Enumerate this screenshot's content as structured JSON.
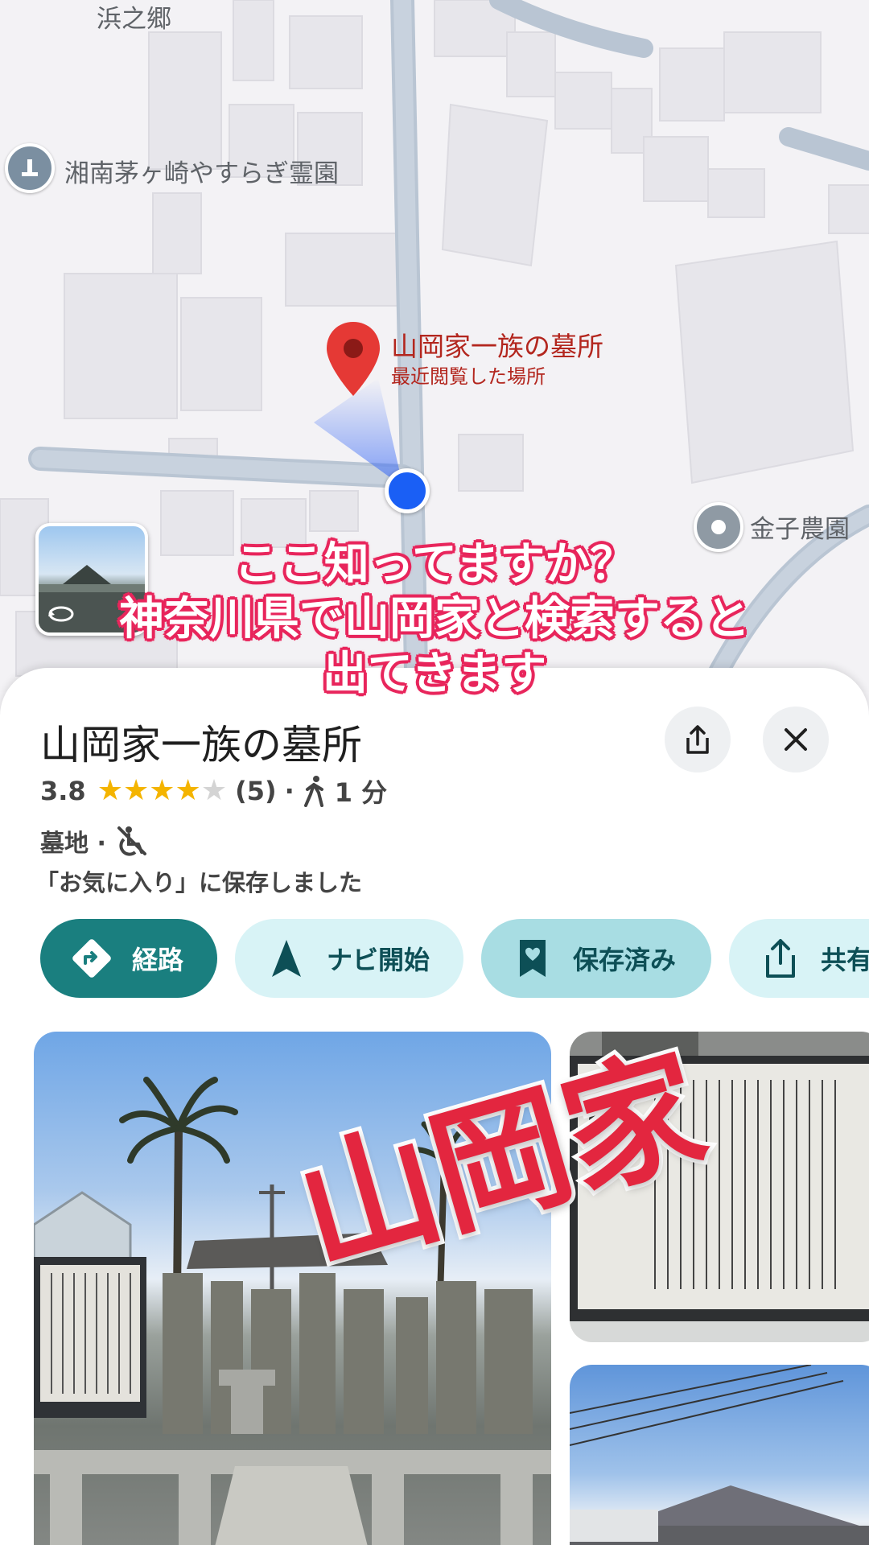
{
  "map": {
    "labels": {
      "area_top": "浜之郷",
      "cemetery": "湘南茅ヶ崎やすらぎ霊園",
      "farm": "金子農園"
    },
    "pin": {
      "title": "山岡家一族の墓所",
      "subtitle": "最近閲覧した場所"
    },
    "icons": {
      "cemetery": "cemetery-pin-icon",
      "farm": "place-pin-icon",
      "selected": "red-location-pin-icon",
      "my_location": "blue-dot-icon",
      "street_view": "street-view-rotate-icon"
    }
  },
  "caption": {
    "line1": "ここ知ってますか？",
    "line2": "神奈川県で山岡家と検索すると",
    "line3": "出てきます"
  },
  "place": {
    "name": "山岡家一族の墓所",
    "rating": "3.8",
    "rating_value": 3.8,
    "stars_max": 5,
    "review_count": "(5)",
    "separator": "·",
    "walk_time": "1 分",
    "category": "墓地 ·",
    "saved_note": "「お気に入り」に保存しました",
    "share_icon": "share-icon",
    "close_icon": "close-icon"
  },
  "actions": {
    "route": "経路",
    "navi": "ナビ開始",
    "saved": "保存済み",
    "share": "共有"
  },
  "photo_overlay": {
    "text": "山岡家"
  },
  "colors": {
    "accent": "#1a7f7f",
    "chip_light": "#d8f3f6",
    "pin_red": "#e53935",
    "caption_outline": "#e8265c",
    "overlay_red": "#e3263f"
  }
}
